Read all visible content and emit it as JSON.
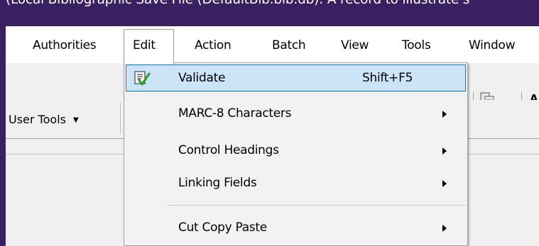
{
  "window": {
    "title": "(Local Bibliographic Save File (DefaultBib.bib.db): A record to illustrate s"
  },
  "menubar": {
    "items": [
      {
        "label": "Authorities"
      },
      {
        "label": "Edit"
      },
      {
        "label": "Action"
      },
      {
        "label": "Batch"
      },
      {
        "label": "View"
      },
      {
        "label": "Tools"
      },
      {
        "label": "Window"
      }
    ]
  },
  "toolbar": {
    "text_icon_label": "AI"
  },
  "user_tools": {
    "label": "User Tools"
  },
  "edit_menu": {
    "items": [
      {
        "label": "Validate",
        "shortcut": "Shift+F5",
        "icon": "validate-check-icon",
        "highlighted": true
      },
      {
        "label": "MARC-8 Characters",
        "submenu": true
      },
      {
        "label": "Control Headings",
        "submenu": true
      },
      {
        "label": "Linking Fields",
        "submenu": true
      },
      {
        "label": "Cut Copy Paste",
        "submenu": true
      }
    ]
  },
  "colors": {
    "title_bar": "#3a1f62",
    "highlight_fill": "#cce4f7",
    "highlight_border": "#0078d7"
  }
}
